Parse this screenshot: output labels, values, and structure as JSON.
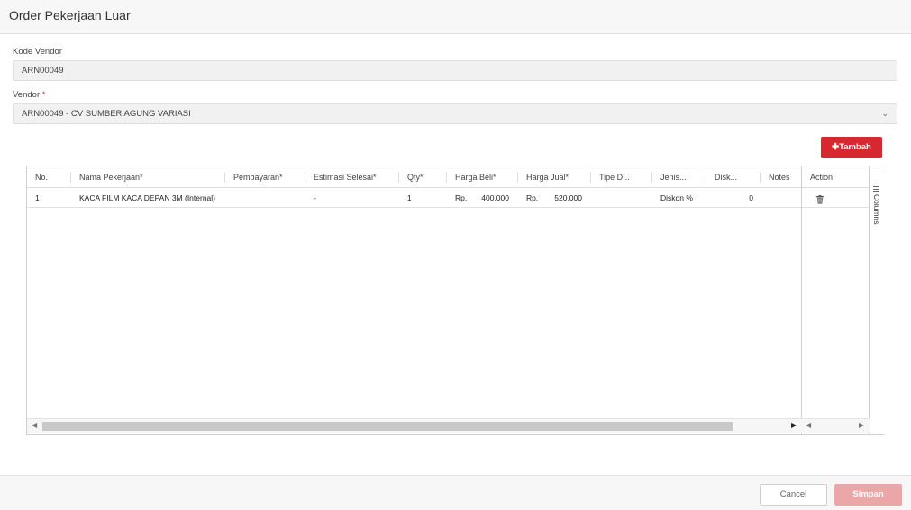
{
  "window": {
    "title": "Order Pekerjaan Luar"
  },
  "form": {
    "kode_vendor_label": "Kode Vendor",
    "kode_vendor_value": "ARN00049",
    "vendor_label": "Vendor",
    "vendor_required_mark": "*",
    "vendor_value": "ARN00049 - CV SUMBER AGUNG VARIASI"
  },
  "toolbar": {
    "add_label": "Tambah",
    "add_icon": "plus-icon"
  },
  "table": {
    "headers": [
      "No.",
      "Nama Pekerjaan*",
      "Pembayaran*",
      "Estimasi Selesai*",
      "Qty*",
      "Harga Beli*",
      "Harga Jual*",
      "Tipe D...",
      "Jenis...",
      "Disk...",
      "Notes"
    ],
    "action_header": "Action",
    "rows": [
      {
        "no": "1",
        "nama_pekerjaan": "KACA FILM KACA DEPAN 3M (Internal)",
        "pembayaran": "",
        "estimasi_selesai": "-",
        "qty": "1",
        "harga_beli_currency": "Rp.",
        "harga_beli": "400,000",
        "harga_jual_currency": "Rp.",
        "harga_jual": "520,000",
        "tipe_diskon": "",
        "jenis_diskon": "Diskon %",
        "diskon": "0",
        "notes": ""
      }
    ],
    "side_panel_label": "Columns"
  },
  "footer": {
    "cancel_label": "Cancel",
    "save_label": "Simpan"
  },
  "colors": {
    "accent_red": "#d7282f",
    "save_disabled": "#eba6a8"
  }
}
